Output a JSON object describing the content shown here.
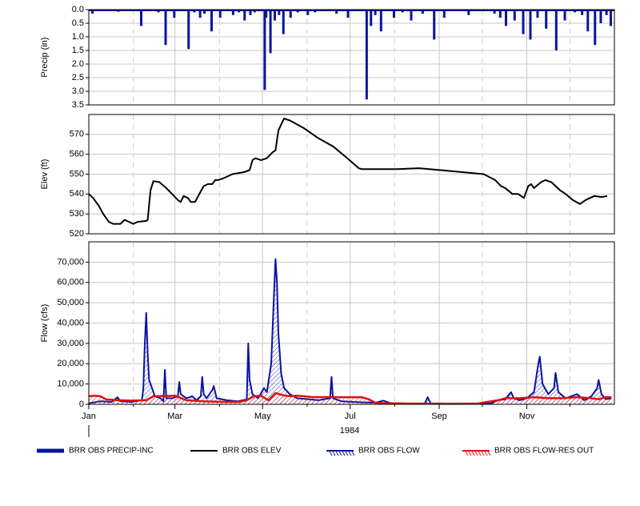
{
  "chart_data": [
    {
      "id": "precip",
      "type": "bar",
      "ylabel": "Precip (in)",
      "ylim": [
        0,
        3.5
      ],
      "y_inverted": true,
      "yticks": [
        "0.0",
        "0.5",
        "1.0",
        "1.5",
        "2.0",
        "2.5",
        "3.0",
        "3.5"
      ],
      "grid": true,
      "color": "#0a14a0",
      "x_day_of_year": [
        2,
        6,
        8,
        20,
        36,
        48,
        53,
        59,
        60,
        69,
        73,
        77,
        80,
        85,
        91,
        95,
        100,
        104,
        108,
        112,
        115,
        120,
        123,
        126,
        129,
        132,
        135,
        140,
        145,
        152,
        157,
        164,
        172,
        180,
        185,
        191,
        196,
        199,
        203,
        206,
        212,
        218,
        224,
        232,
        240,
        247,
        256,
        264,
        272,
        282,
        286,
        290,
        296,
        302,
        307,
        312,
        318,
        325,
        331,
        338,
        343,
        347,
        352,
        356,
        360,
        363
      ],
      "values": [
        0.15,
        0.02,
        0.05,
        0.08,
        0.6,
        0.1,
        1.3,
        0.3,
        0.05,
        1.45,
        0.1,
        0.3,
        0.15,
        0.8,
        0.3,
        0.05,
        0.2,
        0.1,
        0.4,
        0.2,
        0.1,
        0.05,
        0.3,
        1.6,
        0.4,
        0.2,
        0.9,
        0.3,
        0.1,
        0.2,
        0.1,
        0.05,
        0.15,
        0.3,
        0.05,
        0.05,
        0.6,
        0.2,
        0.8,
        0.05,
        0.3,
        0.1,
        0.4,
        0.15,
        1.1,
        0.3,
        0.05,
        0.2,
        0.05,
        0.15,
        0.3,
        0.6,
        0.4,
        0.9,
        1.1,
        0.3,
        0.7,
        1.5,
        0.4,
        0.1,
        0.2,
        0.8,
        1.3,
        0.5,
        0.2,
        0.6
      ],
      "peaks": [
        [
          122,
          2.95
        ],
        [
          193,
          3.3
        ]
      ]
    },
    {
      "id": "elev",
      "type": "line",
      "ylabel": "Elev (ft)",
      "ylim": [
        520,
        580
      ],
      "yticks": [
        "520",
        "530",
        "540",
        "550",
        "560",
        "570"
      ],
      "grid": true,
      "series": [
        {
          "color": "#000000",
          "points": [
            [
              0,
              540
            ],
            [
              3,
              538
            ],
            [
              7,
              534
            ],
            [
              10,
              530
            ],
            [
              14,
              526
            ],
            [
              17,
              525
            ],
            [
              22,
              525
            ],
            [
              25,
              527
            ],
            [
              28,
              526
            ],
            [
              31,
              525
            ],
            [
              34,
              526
            ],
            [
              40,
              526.5
            ],
            [
              41,
              527
            ],
            [
              43,
              542
            ],
            [
              45,
              546.5
            ],
            [
              49,
              546
            ],
            [
              54,
              543
            ],
            [
              58,
              540
            ],
            [
              62,
              537
            ],
            [
              64,
              536
            ],
            [
              66,
              539
            ],
            [
              69,
              538
            ],
            [
              71,
              536
            ],
            [
              74,
              536
            ],
            [
              77,
              540
            ],
            [
              80,
              544
            ],
            [
              83,
              545
            ],
            [
              86,
              545
            ],
            [
              88,
              547
            ],
            [
              90,
              547
            ],
            [
              94,
              548
            ],
            [
              100,
              550
            ],
            [
              108,
              551
            ],
            [
              112,
              552
            ],
            [
              114,
              557
            ],
            [
              116,
              558
            ],
            [
              120,
              557
            ],
            [
              124,
              558
            ],
            [
              128,
              561
            ],
            [
              130,
              562
            ],
            [
              132,
              572
            ],
            [
              134,
              575
            ],
            [
              136,
              578
            ],
            [
              140,
              577
            ],
            [
              145,
              575
            ],
            [
              150,
              573
            ],
            [
              160,
              568
            ],
            [
              170,
              564
            ],
            [
              180,
              558
            ],
            [
              188,
              553
            ],
            [
              190,
              552.5
            ],
            [
              200,
              552.5
            ],
            [
              215,
              552.5
            ],
            [
              230,
              553
            ],
            [
              245,
              552
            ],
            [
              260,
              551
            ],
            [
              275,
              550
            ],
            [
              283,
              547
            ],
            [
              287,
              544
            ],
            [
              290,
              543
            ],
            [
              295,
              540
            ],
            [
              299,
              540
            ],
            [
              303,
              538
            ],
            [
              306,
              544
            ],
            [
              308,
              545
            ],
            [
              310,
              543
            ],
            [
              315,
              546
            ],
            [
              318,
              547
            ],
            [
              322,
              546
            ],
            [
              328,
              542
            ],
            [
              332,
              540
            ],
            [
              337,
              537
            ],
            [
              342,
              535
            ],
            [
              346,
              537
            ],
            [
              352,
              539
            ],
            [
              357,
              538.5
            ],
            [
              361,
              539
            ]
          ]
        }
      ]
    },
    {
      "id": "flow",
      "type": "line",
      "ylabel": "Flow (cfs)",
      "ylim": [
        0,
        80000
      ],
      "yticks": [
        "0",
        "10,000",
        "20,000",
        "30,000",
        "40,000",
        "50,000",
        "60,000",
        "70,000"
      ],
      "grid": true,
      "xlabel": "1984",
      "xticks": [
        "Jan",
        "Mar",
        "May",
        "Jul",
        "Sep",
        "Nov"
      ],
      "series": [
        {
          "color": "#0a14a0",
          "points": [
            [
              0,
              500
            ],
            [
              8,
              1500
            ],
            [
              16,
              1200
            ],
            [
              20,
              3500
            ],
            [
              22,
              1500
            ],
            [
              30,
              1200
            ],
            [
              37,
              2000
            ],
            [
              38,
              8000
            ],
            [
              39,
              30000
            ],
            [
              40,
              45000
            ],
            [
              41,
              25000
            ],
            [
              42,
              12000
            ],
            [
              44,
              8000
            ],
            [
              46,
              4000
            ],
            [
              50,
              3000
            ],
            [
              52,
              1500
            ],
            [
              53,
              17000
            ],
            [
              54,
              3000
            ],
            [
              58,
              3000
            ],
            [
              62,
              4000
            ],
            [
              63,
              11000
            ],
            [
              64,
              5000
            ],
            [
              68,
              3000
            ],
            [
              72,
              4000
            ],
            [
              75,
              2000
            ],
            [
              78,
              4000
            ],
            [
              79,
              13500
            ],
            [
              80,
              5000
            ],
            [
              82,
              3000
            ],
            [
              86,
              7000
            ],
            [
              87,
              9000
            ],
            [
              89,
              3000
            ],
            [
              96,
              2000
            ],
            [
              104,
              1500
            ],
            [
              110,
              2500
            ],
            [
              111,
              30000
            ],
            [
              112,
              12000
            ],
            [
              114,
              5000
            ],
            [
              118,
              3000
            ],
            [
              122,
              8000
            ],
            [
              124,
              6000
            ],
            [
              127,
              20000
            ],
            [
              129,
              55000
            ],
            [
              130,
              71500
            ],
            [
              131,
              60000
            ],
            [
              132,
              35000
            ],
            [
              134,
              15000
            ],
            [
              136,
              8000
            ],
            [
              140,
              5000
            ],
            [
              145,
              3000
            ],
            [
              160,
              2000
            ],
            [
              168,
              3000
            ],
            [
              169,
              13500
            ],
            [
              170,
              3000
            ],
            [
              176,
              1500
            ],
            [
              190,
              1000
            ],
            [
              200,
              800
            ],
            [
              205,
              1800
            ],
            [
              210,
              600
            ],
            [
              220,
              400
            ],
            [
              234,
              500
            ],
            [
              236,
              3500
            ],
            [
              238,
              500
            ],
            [
              250,
              400
            ],
            [
              280,
              500
            ],
            [
              285,
              2000
            ],
            [
              290,
              2500
            ],
            [
              294,
              6000
            ],
            [
              296,
              3000
            ],
            [
              300,
              2000
            ],
            [
              305,
              3000
            ],
            [
              310,
              6000
            ],
            [
              313,
              20000
            ],
            [
              314,
              23500
            ],
            [
              316,
              10000
            ],
            [
              320,
              5000
            ],
            [
              324,
              8000
            ],
            [
              325,
              15500
            ],
            [
              327,
              6000
            ],
            [
              332,
              3000
            ],
            [
              340,
              5000
            ],
            [
              345,
              2000
            ],
            [
              350,
              4000
            ],
            [
              354,
              8000
            ],
            [
              355,
              12000
            ],
            [
              357,
              5000
            ],
            [
              360,
              2500
            ],
            [
              364,
              3000
            ]
          ]
        },
        {
          "color": "#e01010",
          "points": [
            [
              0,
              4000
            ],
            [
              4,
              4200
            ],
            [
              8,
              4000
            ],
            [
              12,
              2500
            ],
            [
              20,
              2000
            ],
            [
              30,
              1800
            ],
            [
              40,
              2000
            ],
            [
              45,
              4000
            ],
            [
              60,
              4200
            ],
            [
              68,
              2000
            ],
            [
              80,
              1500
            ],
            [
              95,
              1200
            ],
            [
              105,
              1200
            ],
            [
              110,
              2000
            ],
            [
              115,
              4000
            ],
            [
              120,
              4200
            ],
            [
              125,
              2000
            ],
            [
              130,
              5500
            ],
            [
              135,
              4500
            ],
            [
              140,
              4000
            ],
            [
              145,
              4200
            ],
            [
              150,
              4000
            ],
            [
              155,
              3600
            ],
            [
              175,
              3500
            ],
            [
              190,
              3500
            ],
            [
              195,
              2500
            ],
            [
              200,
              600
            ],
            [
              210,
              500
            ],
            [
              230,
              300
            ],
            [
              250,
              300
            ],
            [
              270,
              300
            ],
            [
              280,
              1500
            ],
            [
              285,
              2000
            ],
            [
              290,
              3000
            ],
            [
              300,
              3000
            ],
            [
              310,
              3500
            ],
            [
              320,
              3000
            ],
            [
              330,
              3000
            ],
            [
              340,
              3500
            ],
            [
              350,
              3000
            ],
            [
              355,
              2500
            ],
            [
              360,
              3500
            ],
            [
              364,
              3500
            ]
          ]
        }
      ]
    }
  ],
  "legend": [
    {
      "name": "BRR OBS PRECIP-INC",
      "color": "#0a14a0",
      "style": "bar"
    },
    {
      "name": "BRR OBS ELEV",
      "color": "#000000",
      "style": "line"
    },
    {
      "name": "BRR OBS FLOW",
      "color": "#0a14a0",
      "style": "hatched-line"
    },
    {
      "name": "BRR OBS FLOW-RES OUT",
      "color": "#e01010",
      "style": "hatched-line"
    }
  ]
}
